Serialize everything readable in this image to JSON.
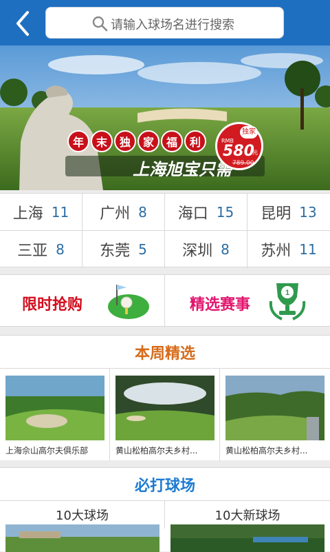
{
  "header": {
    "search_placeholder": "请输入球场名进行搜索",
    "colors": {
      "bar": "#1f6fc1"
    }
  },
  "banner": {
    "tag_chars": [
      "年",
      "末",
      "独",
      "家",
      "福",
      "利"
    ],
    "subtitle": "上海旭宝只需",
    "price": {
      "currency": "RMB",
      "badge": "独家",
      "value": "580",
      "unit": "元",
      "old_value": "789.00"
    }
  },
  "cities": [
    {
      "name": "上海",
      "count": "11"
    },
    {
      "name": "广州",
      "count": "8"
    },
    {
      "name": "海口",
      "count": "15"
    },
    {
      "name": "昆明",
      "count": "13"
    },
    {
      "name": "三亚",
      "count": "8"
    },
    {
      "name": "东莞",
      "count": "5"
    },
    {
      "name": "深圳",
      "count": "8"
    },
    {
      "name": "苏州",
      "count": "11"
    }
  ],
  "promos": {
    "left": {
      "label": "限时抢购",
      "icon": "golf-flag-icon"
    },
    "right": {
      "label": "精选赛事",
      "icon": "trophy-icon"
    }
  },
  "weekly": {
    "title": "本周精选",
    "cards": [
      {
        "caption": "上海佘山高尔夫俱乐部"
      },
      {
        "caption": "黄山松柏高尔夫乡村..."
      },
      {
        "caption": "黄山松柏高尔夫乡村..."
      }
    ]
  },
  "must": {
    "title": "必打球场",
    "left": "10大球场",
    "right": "10大新球场"
  }
}
